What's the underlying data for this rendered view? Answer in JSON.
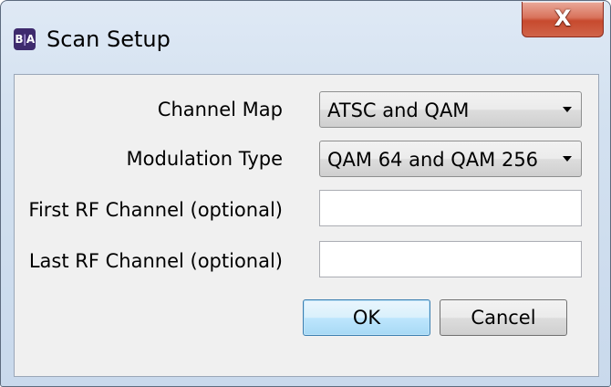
{
  "window": {
    "title": "Scan Setup",
    "app_icon_left": "B",
    "app_icon_right": "A",
    "close_glyph": "X"
  },
  "form": {
    "channel_map": {
      "label": "Channel Map",
      "selected": "ATSC and QAM"
    },
    "modulation_type": {
      "label": "Modulation Type",
      "selected": "QAM 64 and QAM 256"
    },
    "first_rf_channel": {
      "label": "First RF Channel (optional)",
      "value": ""
    },
    "last_rf_channel": {
      "label": "Last RF Channel (optional)",
      "value": ""
    }
  },
  "buttons": {
    "ok_label": "OK",
    "cancel_label": "Cancel"
  },
  "colors": {
    "app_icon_bg": "#3e2a6d",
    "close_button": "#c74a2e",
    "ok_button_border": "#3c7fb1"
  }
}
